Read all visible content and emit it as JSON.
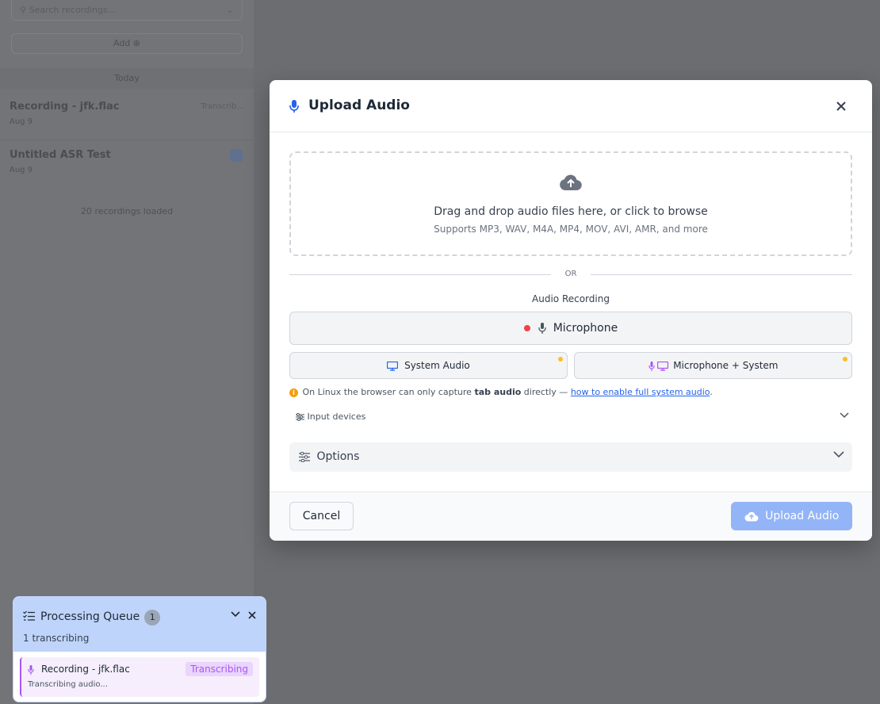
{
  "background": {
    "search_placeholder": "Search recordings...",
    "add_button": "Add ⊕",
    "section_label": "Today",
    "recordings": [
      {
        "title": "Recording - jfk.flac",
        "meta": "Aug 9",
        "right": "Transcrib..."
      },
      {
        "title": "Untitled ASR Test",
        "meta": "Aug 9"
      }
    ],
    "count_label": "20 recordings loaded"
  },
  "modal": {
    "title": "Upload Audio",
    "dropzone": {
      "main": "Drag and drop audio files here, or click to browse",
      "sub": "Supports MP3, WAV, M4A, MP4, MOV, AVI, AMR, and more"
    },
    "or_label": "OR",
    "recording_label": "Audio Recording",
    "microphone_button": "Microphone",
    "system_audio_button": "System Audio",
    "mic_system_button": "Microphone + System",
    "linux_note": {
      "prefix": "On Linux the browser can only capture",
      "bold": "tab audio",
      "middle": "directly —",
      "link": "how to enable full system audio",
      "suffix": "."
    },
    "input_devices_label": "Input devices",
    "options_label": "Options",
    "cancel_button": "Cancel",
    "upload_button": "Upload Audio"
  },
  "queue": {
    "title": "Processing Queue",
    "badge": "1",
    "subtitle": "1 transcribing",
    "items": [
      {
        "name": "Recording - jfk.flac",
        "status": "Transcribing",
        "detail": "Transcribing audio..."
      }
    ]
  },
  "colors": {
    "accent_blue": "#2563eb",
    "upload_disabled": "#93b4f7",
    "record_red": "#ef4444",
    "warning_yellow": "#fbbf24",
    "transcribing_purple": "#a855f7"
  }
}
